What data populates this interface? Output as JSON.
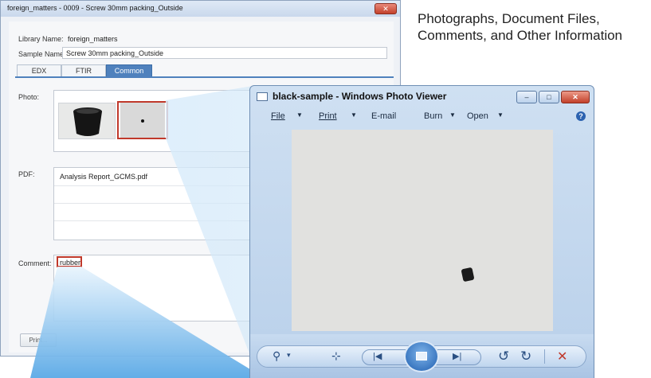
{
  "heading": "Photographs, Document Files, Comments, and Other Information",
  "left_window": {
    "title": "foreign_matters - 0009 - Screw 30mm packing_Outside",
    "close_glyph": "✕",
    "library_name_label": "Library Name:",
    "library_name_value": "foreign_matters",
    "sample_name_label": "Sample Name:",
    "sample_name_value": "Screw 30mm packing_Outside",
    "tabs": [
      {
        "label": "EDX"
      },
      {
        "label": "FTIR"
      },
      {
        "label": "Common"
      }
    ],
    "photo_label": "Photo:",
    "pdf_label": "PDF:",
    "pdf_file": "Analysis Report_GCMS.pdf",
    "comment_label": "Comment:",
    "comment_value": "rubber",
    "print_label": "Print..."
  },
  "photo_viewer": {
    "title": "black-sample - Windows Photo Viewer",
    "controls": {
      "minimize": "–",
      "maximize": "□",
      "close": "✕"
    },
    "menu": [
      {
        "label": "File",
        "caret": "▼"
      },
      {
        "label": "Print",
        "caret": "▼"
      },
      {
        "label": "E-mail"
      },
      {
        "label": "Burn",
        "caret": "▼"
      },
      {
        "label": "Open",
        "caret": "▼"
      }
    ],
    "help_glyph": "?",
    "toolbar": {
      "zoom_glyph": "⚲",
      "zoom_caret": "▾",
      "fit_glyph": "⊹",
      "prev_glyph": "|◀",
      "next_glyph": "▶|",
      "rotate_ccw_glyph": "↺",
      "rotate_cw_glyph": "↻",
      "delete_glyph": "✕"
    }
  },
  "colors": {
    "highlight": "#c0392b",
    "tab_active": "#4f81bd",
    "beam": "#6fb6ec"
  }
}
